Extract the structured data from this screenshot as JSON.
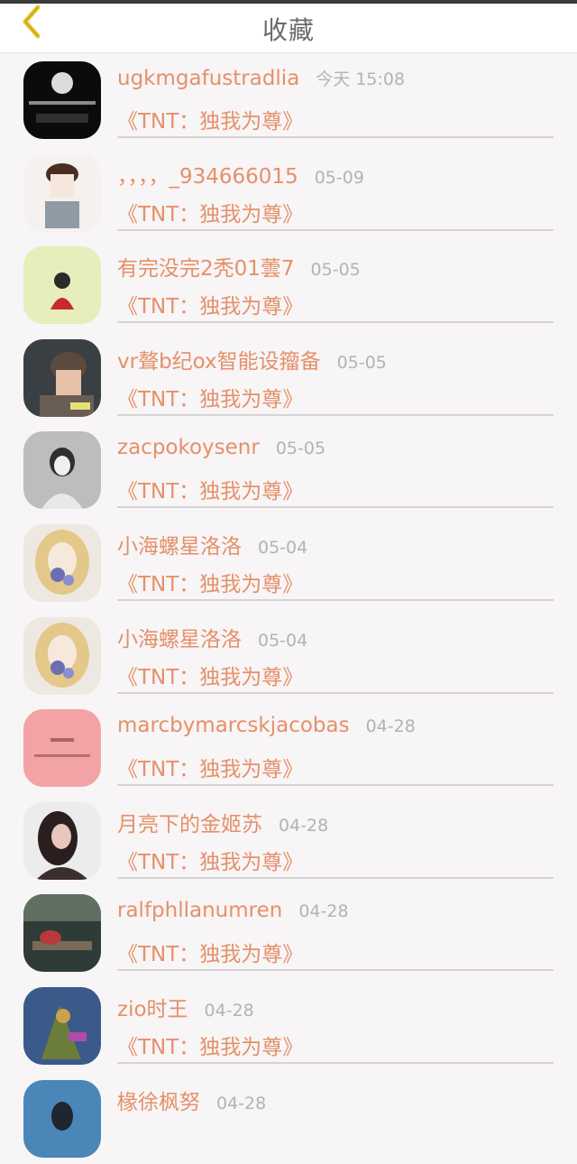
{
  "header": {
    "title": "收藏"
  },
  "icons": {
    "back": "back-arrow-icon"
  },
  "colors": {
    "accent": "#e5906a",
    "back_icon": "#e8c52c",
    "time": "#b3b3b3"
  },
  "items": [
    {
      "name": "ugkmgafustradlia",
      "time": "今天 15:08",
      "work": "《TNT：独我为尊》"
    },
    {
      "name": "，，，，_934666015",
      "time": "05-09",
      "work": "《TNT：独我为尊》"
    },
    {
      "name": "有完没完2秃01蕓7",
      "time": "05-05",
      "work": "《TNT：独我为尊》"
    },
    {
      "name": "vr聱b纪ox智能设籀备",
      "time": "05-05",
      "work": "《TNT：独我为尊》"
    },
    {
      "name": "zacpokoysenr",
      "time": "05-05",
      "work": "《TNT：独我为尊》"
    },
    {
      "name": "小海螺星洛洛",
      "time": "05-04",
      "work": "《TNT：独我为尊》"
    },
    {
      "name": "小海螺星洛洛",
      "time": "05-04",
      "work": "《TNT：独我为尊》"
    },
    {
      "name": "marcbymarcskjacobas",
      "time": "04-28",
      "work": "《TNT：独我为尊》"
    },
    {
      "name": "月亮下的金姬苏",
      "time": "04-28",
      "work": "《TNT：独我为尊》"
    },
    {
      "name": "ralfphllanumren",
      "time": "04-28",
      "work": "《TNT：独我为尊》"
    },
    {
      "name": "zio时王",
      "time": "04-28",
      "work": "《TNT：独我为尊》"
    },
    {
      "name": "椽徐枫努",
      "time": "04-28",
      "work": ""
    }
  ]
}
